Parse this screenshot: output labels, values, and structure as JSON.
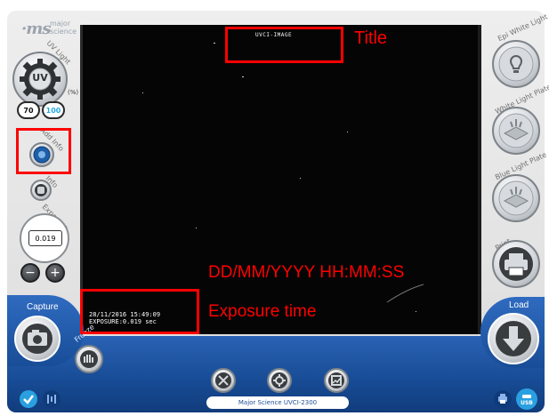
{
  "brand": {
    "line1": "major",
    "line2": "science"
  },
  "left_panel": {
    "uv_light_label": "UV Light",
    "uv_button_label": "UV",
    "percent_unit": "(%)",
    "intensity_options": [
      "70",
      "100"
    ],
    "add_info_label": "Add Info",
    "info_label": "Info",
    "exposure_label": "Exposure",
    "exposure_value": "0.019",
    "minus_symbol": "−",
    "plus_symbol": "+",
    "capture_label": "Capture",
    "freeze_label": "Freeze"
  },
  "image": {
    "title": "UVCI-IMAGE",
    "timestamp": "28/11/2016 15:49:09",
    "exposure_line": "EXPOSURE:0.019 sec"
  },
  "right_panel": {
    "epi_white_label": "Epi White Light",
    "white_plate_label": "White Light Plate",
    "blue_plate_label": "Blue Light Plate",
    "print_label": "Print",
    "load_label": "Load",
    "usb_label": "USB"
  },
  "status_bar": {
    "device": "Major Science UVCI-2300"
  },
  "annotations": {
    "title_label": "Title",
    "datetime_label": "DD/MM/YYYY HH:MM:SS",
    "exposure_time_label": "Exposure time"
  },
  "colors": {
    "annotation": "#ff0000",
    "accent_blue": "#1f4e96",
    "selected_option": "#29a8e0"
  }
}
